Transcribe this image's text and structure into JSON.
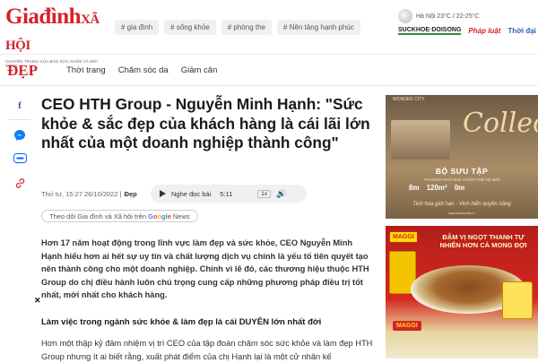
{
  "header": {
    "logo_main": "Giađình",
    "logo_sub": "XÃ HỘI",
    "logo_tagline": "CHUYÊN TRANG CỦA BÁO SỨC KHỎE VÀ ĐỜI SỐNG",
    "tags": [
      "# gia đình",
      "# sống khỏe",
      "# phòng the",
      "# Nền tảng hạnh phúc"
    ],
    "weather": "Hà Nội 23°C / 22-25°C",
    "partners": [
      "SUCKHOE·DOISONG",
      "Pháp luật",
      "Thời đại"
    ]
  },
  "nav": {
    "section": "ĐẸP",
    "links": [
      "Thời trang",
      "Chăm sóc da",
      "Giảm cân"
    ]
  },
  "share": [
    "facebook-icon",
    "messenger-icon",
    "zalo-icon",
    "link-icon"
  ],
  "article": {
    "title": "CEO HTH Group - Nguyễn Minh Hạnh: \"Sức khỏe & sắc đẹp của khách hàng là cái lãi lớn nhất của một doanh nghiệp thành công\"",
    "date": "Thứ tư, 15:27 26/10/2022 |",
    "category": "Đẹp",
    "audio": {
      "label": "Nghe đọc bài",
      "duration": "5:11",
      "speed": "1x"
    },
    "follow_prefix": "Theo dõi Gia đình và Xã hội trên",
    "follow_google": [
      "G",
      "o",
      "o",
      "g",
      "l",
      "e"
    ],
    "follow_news": "News",
    "sapo": "Hơn 17 năm hoạt động trong lĩnh vực làm đẹp và sức khỏe, CEO Nguyễn Minh Hạnh hiểu hơn ai hết sự uy tín và chất lượng dịch vụ chính là yếu tố tiên quyết tạo nên thành công cho một doanh nghiệp. Chính vì lẽ đó, các thương hiệu thuộc HTH Group do chị điều hành luôn chú trọng cung cấp những phương pháp điều trị tốt nhất, mới nhất cho khách hàng.",
    "subhead": "Làm việc trong ngành sức khỏe & làm đẹp là cái DUYÊN lớn nhất đời",
    "body": "Hơn một thập kỷ đảm nhiệm vị trí CEO của tập đoàn chăm sóc sức khỏe và làm đẹp HTH Group nhưng ít ai biết rằng, xuất phát điểm của chị Hạnh lại là một cử nhân kế"
  },
  "ads": {
    "ad1": {
      "brand": "WONDER CITY",
      "script": "Collection",
      "title": "BỘ SƯU TẬP",
      "subtitle": "THƯƠNG PHỐ NHÀ VƯỜN THẾ HỆ MỚI",
      "stats": [
        "8m",
        "120m²",
        "0m"
      ],
      "tagline": "Tinh hoa giới hạn - Vinh hiển quyền năng",
      "footer": "www.wondercity.vn"
    },
    "ad2": {
      "brand": "MAGGI",
      "headline": "ĐẬM VỊ NGỌT THANH TỰ NHIÊN HƠN CẢ MONG ĐỢI",
      "brand2": "MAGGI"
    }
  }
}
